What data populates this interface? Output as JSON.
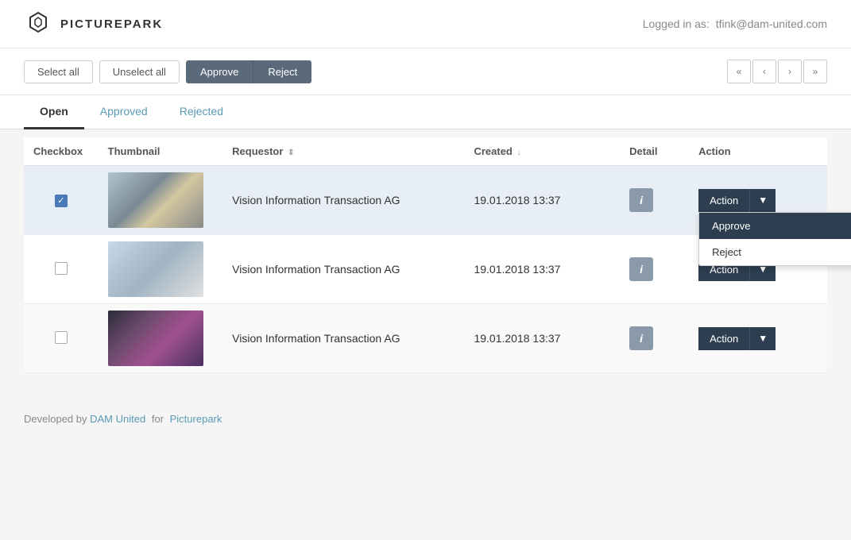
{
  "header": {
    "logo_text": "PICTUREPARK",
    "logged_in_label": "Logged in as:",
    "logged_in_user": "tfink@dam-united.com"
  },
  "toolbar": {
    "select_all_label": "Select all",
    "unselect_all_label": "Unselect all",
    "approve_label": "Approve",
    "reject_label": "Reject",
    "pagination": {
      "prev_first": "«",
      "prev": "‹",
      "next": "›",
      "next_last": "»"
    }
  },
  "tabs": [
    {
      "id": "open",
      "label": "Open",
      "active": true
    },
    {
      "id": "approved",
      "label": "Approved",
      "active": false
    },
    {
      "id": "rejected",
      "label": "Rejected",
      "active": false
    }
  ],
  "table": {
    "columns": {
      "checkbox": "Checkbox",
      "thumbnail": "Thumbnail",
      "requestor": "Requestor",
      "created": "Created",
      "detail": "Detail",
      "action": "Action"
    },
    "rows": [
      {
        "id": "row-1",
        "checked": true,
        "requestor": "Vision Information Transaction AG",
        "created": "19.01.2018 13:37",
        "thumb_class": "thumb-1",
        "show_dropdown": true
      },
      {
        "id": "row-2",
        "checked": false,
        "requestor": "Vision Information Transaction AG",
        "created": "19.01.2018 13:37",
        "thumb_class": "thumb-2",
        "show_dropdown": false
      },
      {
        "id": "row-3",
        "checked": false,
        "requestor": "Vision Information Transaction AG",
        "created": "19.01.2018 13:37",
        "thumb_class": "thumb-3",
        "show_dropdown": false
      }
    ],
    "dropdown_items": {
      "approve": "Approve",
      "reject": "Reject"
    },
    "action_label": "Action"
  },
  "footer": {
    "developed_by": "Developed by",
    "dam_united": "DAM United",
    "for_text": "for",
    "picturepark": "Picturepark"
  }
}
